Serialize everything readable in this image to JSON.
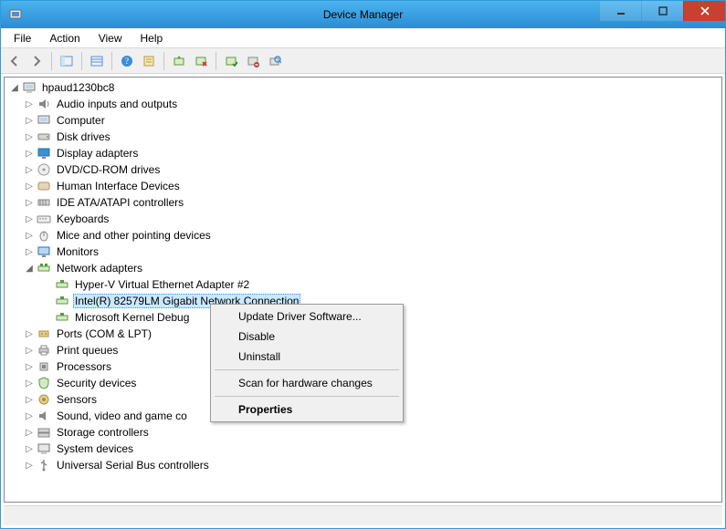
{
  "window": {
    "title": "Device Manager"
  },
  "menu": {
    "file": "File",
    "action": "Action",
    "view": "View",
    "help": "Help"
  },
  "root": "hpaud1230bc8",
  "cats": {
    "audio": "Audio inputs and outputs",
    "computer": "Computer",
    "disk": "Disk drives",
    "display": "Display adapters",
    "dvd": "DVD/CD-ROM drives",
    "hid": "Human Interface Devices",
    "ide": "IDE ATA/ATAPI controllers",
    "keyboard": "Keyboards",
    "mice": "Mice and other pointing devices",
    "monitors": "Monitors",
    "network": "Network adapters",
    "net0": "Hyper-V Virtual Ethernet Adapter #2",
    "net1": "Intel(R) 82579LM Gigabit Network Connection",
    "net2": "Microsoft Kernel Debug",
    "ports": "Ports (COM & LPT)",
    "printq": "Print queues",
    "proc": "Processors",
    "secdev": "Security devices",
    "sensors": "Sensors",
    "svgc": "Sound, video and game co",
    "storage": "Storage controllers",
    "sysdev": "System devices",
    "usb": "Universal Serial Bus controllers"
  },
  "ctx": {
    "update": "Update Driver Software...",
    "disable": "Disable",
    "uninstall": "Uninstall",
    "scan": "Scan for hardware changes",
    "properties": "Properties"
  }
}
